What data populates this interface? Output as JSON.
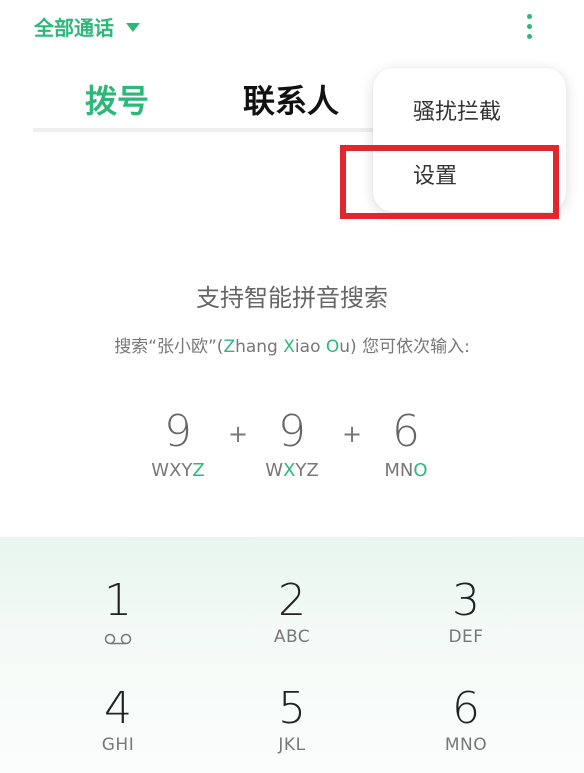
{
  "header": {
    "filter_label": "全部通话",
    "more_icon": "more-vertical-icon"
  },
  "tabs": [
    {
      "label": "拨号",
      "active": true
    },
    {
      "label": "联系人",
      "active": false
    }
  ],
  "menu": {
    "items": [
      {
        "label": "骚扰拦截"
      },
      {
        "label": "设置",
        "highlighted": true
      }
    ]
  },
  "hint": {
    "title": "支持智能拼音搜索",
    "sub_prefix": "搜索“张小欧”(",
    "z": "Z",
    "zhang_rest": "hang ",
    "x": "X",
    "xiao_rest": "iao ",
    "o": "O",
    "ou_rest": "u",
    "sub_suffix": ") 您可依次输入:"
  },
  "example": {
    "plus": "+",
    "keys": [
      {
        "digit": "9",
        "letters_plain": "WXY",
        "letters_hl": "Z",
        "letters_after": ""
      },
      {
        "digit": "9",
        "letters_plain": "W",
        "letters_hl": "X",
        "letters_after": "YZ"
      },
      {
        "digit": "6",
        "letters_plain": "MN",
        "letters_hl": "O",
        "letters_after": ""
      }
    ]
  },
  "keypad": {
    "keys": [
      {
        "digit": "1",
        "letters": "",
        "icon": "voicemail-icon"
      },
      {
        "digit": "2",
        "letters": "ABC"
      },
      {
        "digit": "3",
        "letters": "DEF"
      },
      {
        "digit": "4",
        "letters": "GHI"
      },
      {
        "digit": "5",
        "letters": "JKL"
      },
      {
        "digit": "6",
        "letters": "MNO"
      }
    ]
  },
  "colors": {
    "accent": "#2db87a",
    "highlight_border": "#e2262b",
    "keypad_bg": "#e7f5ef"
  }
}
